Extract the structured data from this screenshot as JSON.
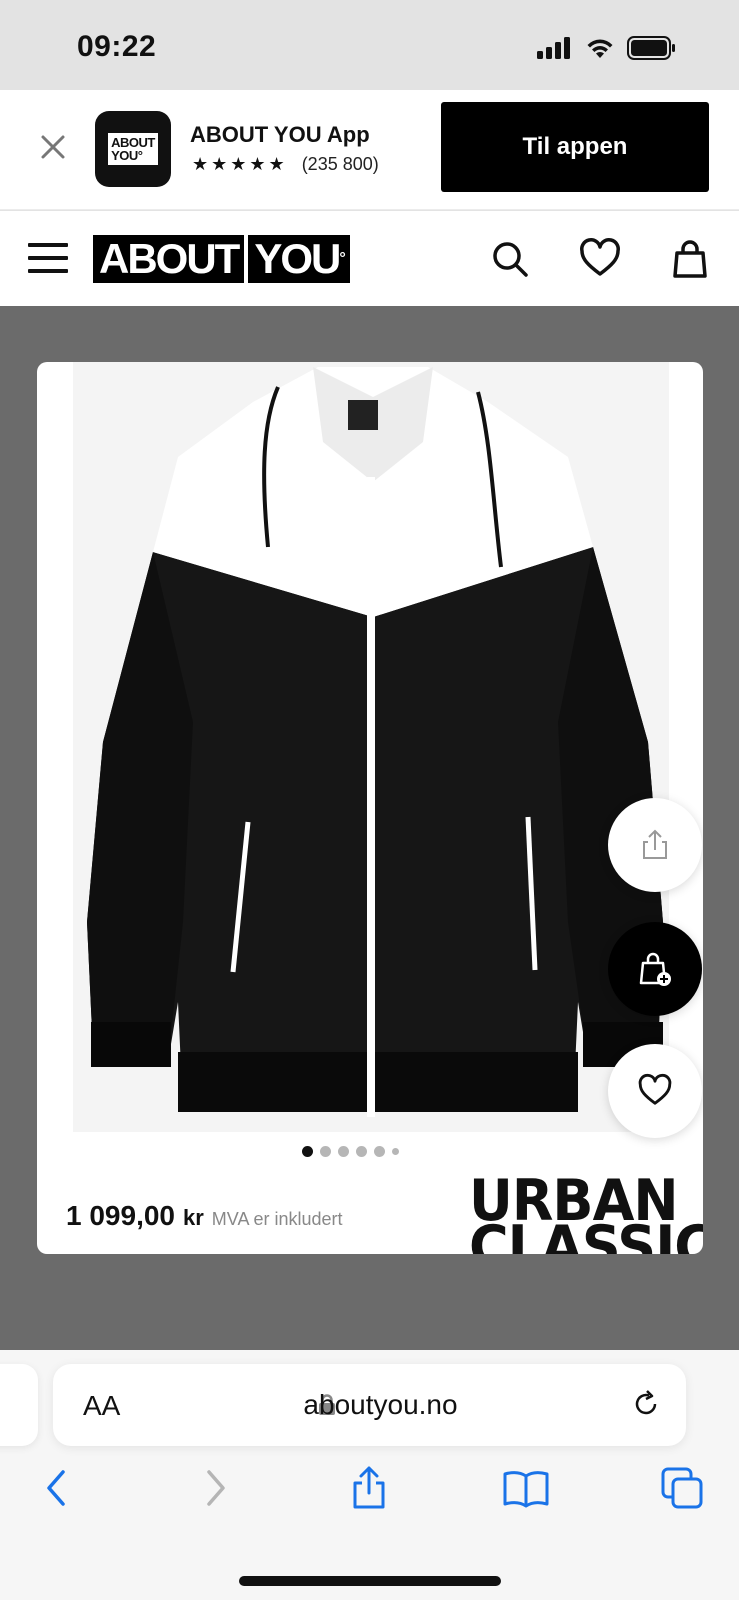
{
  "status_bar": {
    "time": "09:22"
  },
  "app_banner": {
    "app_name": "ABOUT YOU App",
    "rating_stars": "★★★★★",
    "rating_count": "(235 800)",
    "icon_logo_line1": "ABOUT",
    "icon_logo_line2": "YOU°",
    "open_button": "Til appen"
  },
  "header": {
    "brand_part1": "ABOUT",
    "brand_part2": "YOU"
  },
  "product": {
    "price_value": "1 099,00",
    "price_currency": "kr",
    "vat_note": "MVA er inkludert",
    "brand_logo_line1": "URBAN",
    "brand_logo_line2": "CLASSICS",
    "image_count": 6,
    "active_image": 1
  },
  "browser": {
    "text_size_label": "AA",
    "url": "aboutyou.no"
  },
  "colors": {
    "overlay": "#6b6b6b",
    "ios_blue": "#1a73e8",
    "black": "#000000"
  },
  "icons": [
    "close-icon",
    "menu-icon",
    "search-icon",
    "heart-icon",
    "bag-icon",
    "share-icon",
    "bag-plus-icon",
    "lock-icon",
    "reload-icon",
    "back-icon",
    "forward-icon",
    "bookmarks-icon",
    "tabs-icon"
  ]
}
